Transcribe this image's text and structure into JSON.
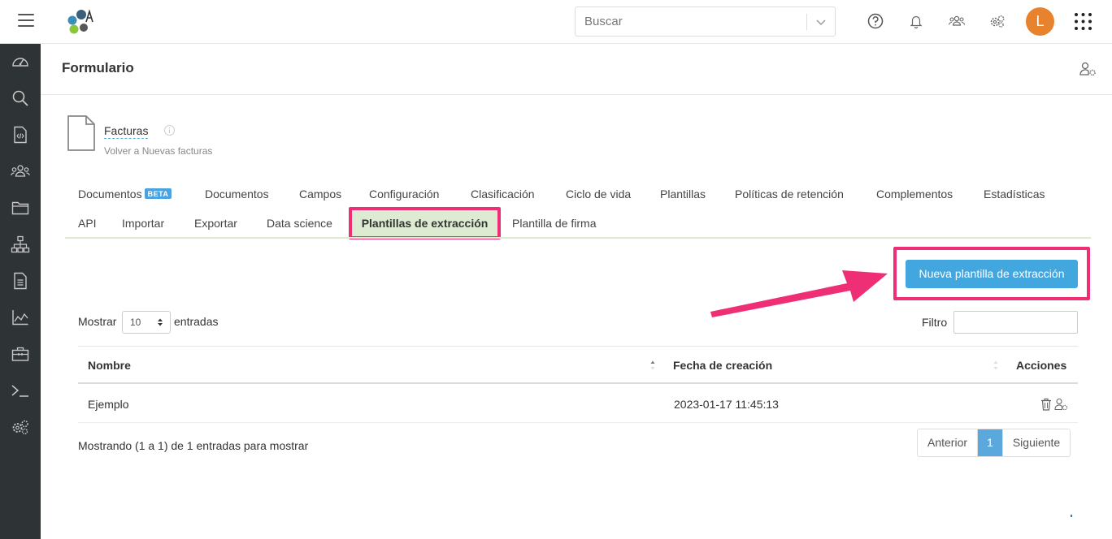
{
  "topbar": {
    "search_placeholder": "Buscar",
    "avatar_initial": "L",
    "avatar_color": "#e9822c"
  },
  "sidebar": {
    "icons": [
      "dashboard-icon",
      "search-icon",
      "code-file-icon",
      "users-icon",
      "folder-icon",
      "hierarchy-icon",
      "document-icon",
      "chart-icon",
      "toolbox-icon",
      "terminal-icon",
      "settings-icon"
    ],
    "background": "#2e3336"
  },
  "page": {
    "title": "Formulario"
  },
  "entity": {
    "name": "Facturas",
    "back_link": "Volver a Nuevas facturas"
  },
  "tabs": {
    "row1": [
      "Documentos",
      "Documentos",
      "Campos",
      "Configuración",
      "Clasificación",
      "Ciclo de vida",
      "Plantillas",
      "Políticas de retención",
      "Complementos",
      "Estadísticas"
    ],
    "beta_badge": "BETA",
    "row2": [
      "API",
      "Importar",
      "Exportar",
      "Data science",
      "Plantillas de extracción",
      "Plantilla de firma"
    ],
    "active": "Plantillas de extracción"
  },
  "actions": {
    "new_button": "Nueva plantilla de extracción",
    "highlight_color": "#ef2f75",
    "button_color": "#43a7df"
  },
  "table_controls": {
    "show_label": "Mostrar",
    "page_length": "10",
    "entries_label": "entradas",
    "filter_label": "Filtro"
  },
  "table": {
    "columns": [
      "Nombre",
      "Fecha de creación",
      "Acciones"
    ],
    "rows": [
      {
        "name": "Ejemplo",
        "created": "2023-01-17 11:45:13"
      }
    ]
  },
  "footer": {
    "info": "Mostrando (1 a 1) de 1 entradas para mostrar",
    "prev": "Anterior",
    "page": "1",
    "next": "Siguiente"
  }
}
